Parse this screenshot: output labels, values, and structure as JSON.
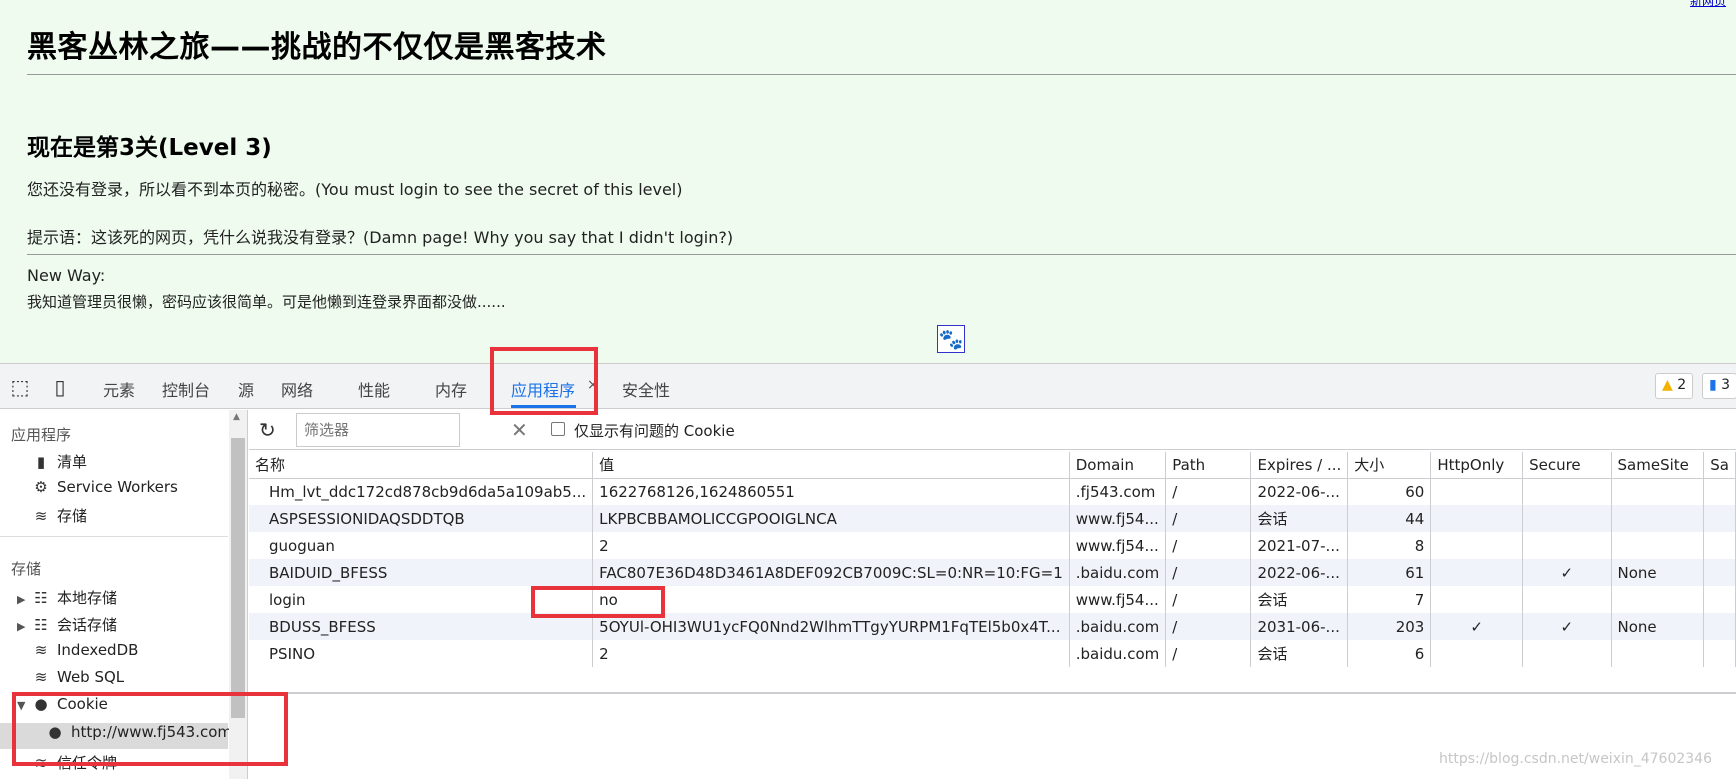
{
  "page": {
    "top_link": "新网页",
    "title": "黑客丛林之旅——挑战的不仅仅是黑客技术",
    "level_heading": "现在是第3关(Level 3)",
    "not_logged_in": "您还没有登录，所以看不到本页的秘密。(You must login to see the secret of this level)",
    "hint": "提示语：这该死的网页，凭什么说我没有登录？(Damn page! Why you say that I didn't login?)",
    "new_way_label": "New Way:",
    "new_way_text": "我知道管理员很懒，密码应该很简单。可是他懒到连登录界面都没做......",
    "paw_icon": "baidu-paw-icon"
  },
  "devtools": {
    "tabs": [
      "元素",
      "控制台",
      "源",
      "网络",
      "性能",
      "内存",
      "应用程序",
      "安全性"
    ],
    "active_tab": "应用程序",
    "warnings_count": "2",
    "messages_count": "3",
    "colors": {
      "accent": "#1a73e8",
      "warning": "#f2b300",
      "highlight": "#e8323c"
    },
    "sidebar": {
      "app_heading": "应用程序",
      "app_items": [
        "清单",
        "Service Workers",
        "存储"
      ],
      "storage_heading": "存储",
      "storage_items": [
        "本地存储",
        "会话存储",
        "IndexedDB",
        "Web SQL",
        "Cookie"
      ],
      "cookie_origin": "http://www.fj543.com",
      "partial_item": "信任令牌"
    },
    "toolbar": {
      "filter_placeholder": "筛选器",
      "only_issues_label": "仅显示有问题的 Cookie"
    },
    "cookie_columns": [
      "名称",
      "值",
      "Domain",
      "Path",
      "Expires / ...",
      "大小",
      "HttpOnly",
      "Secure",
      "SameSite",
      "Sa"
    ],
    "cookies": [
      {
        "name": "Hm_lvt_ddc172cd878cb9d6da5a109ab5...",
        "value": "1622768126,1624860551",
        "domain": ".fj543.com",
        "path": "/",
        "expires": "2022-06-...",
        "size": "60",
        "httponly": "",
        "secure": "",
        "samesite": ""
      },
      {
        "name": "ASPSESSIONIDAQSDDTQB",
        "value": "LKPBCBBAMOLICCGPOOIGLNCA",
        "domain": "www.fj54...",
        "path": "/",
        "expires": "会话",
        "size": "44",
        "httponly": "",
        "secure": "",
        "samesite": ""
      },
      {
        "name": "guoguan",
        "value": "2",
        "domain": "www.fj54...",
        "path": "/",
        "expires": "2021-07-...",
        "size": "8",
        "httponly": "",
        "secure": "",
        "samesite": ""
      },
      {
        "name": "BAIDUID_BFESS",
        "value": "FAC807E36D48D3461A8DEF092CB7009C:SL=0:NR=10:FG=1",
        "domain": ".baidu.com",
        "path": "/",
        "expires": "2022-06-...",
        "size": "61",
        "httponly": "",
        "secure": "✓",
        "samesite": "None"
      },
      {
        "name": "login",
        "value": "no",
        "domain": "www.fj54...",
        "path": "/",
        "expires": "会话",
        "size": "7",
        "httponly": "",
        "secure": "",
        "samesite": ""
      },
      {
        "name": "BDUSS_BFESS",
        "value": "5OYUl-OHI3WU1ycFQ0Nnd2WlhmTTgyYURPM1FqTEl5b0x4T...",
        "domain": ".baidu.com",
        "path": "/",
        "expires": "2031-06-...",
        "size": "203",
        "httponly": "✓",
        "secure": "✓",
        "samesite": "None"
      },
      {
        "name": "PSINO",
        "value": "2",
        "domain": ".baidu.com",
        "path": "/",
        "expires": "会话",
        "size": "6",
        "httponly": "",
        "secure": "",
        "samesite": ""
      }
    ]
  },
  "watermark": "https://blog.csdn.net/weixin_47602346"
}
